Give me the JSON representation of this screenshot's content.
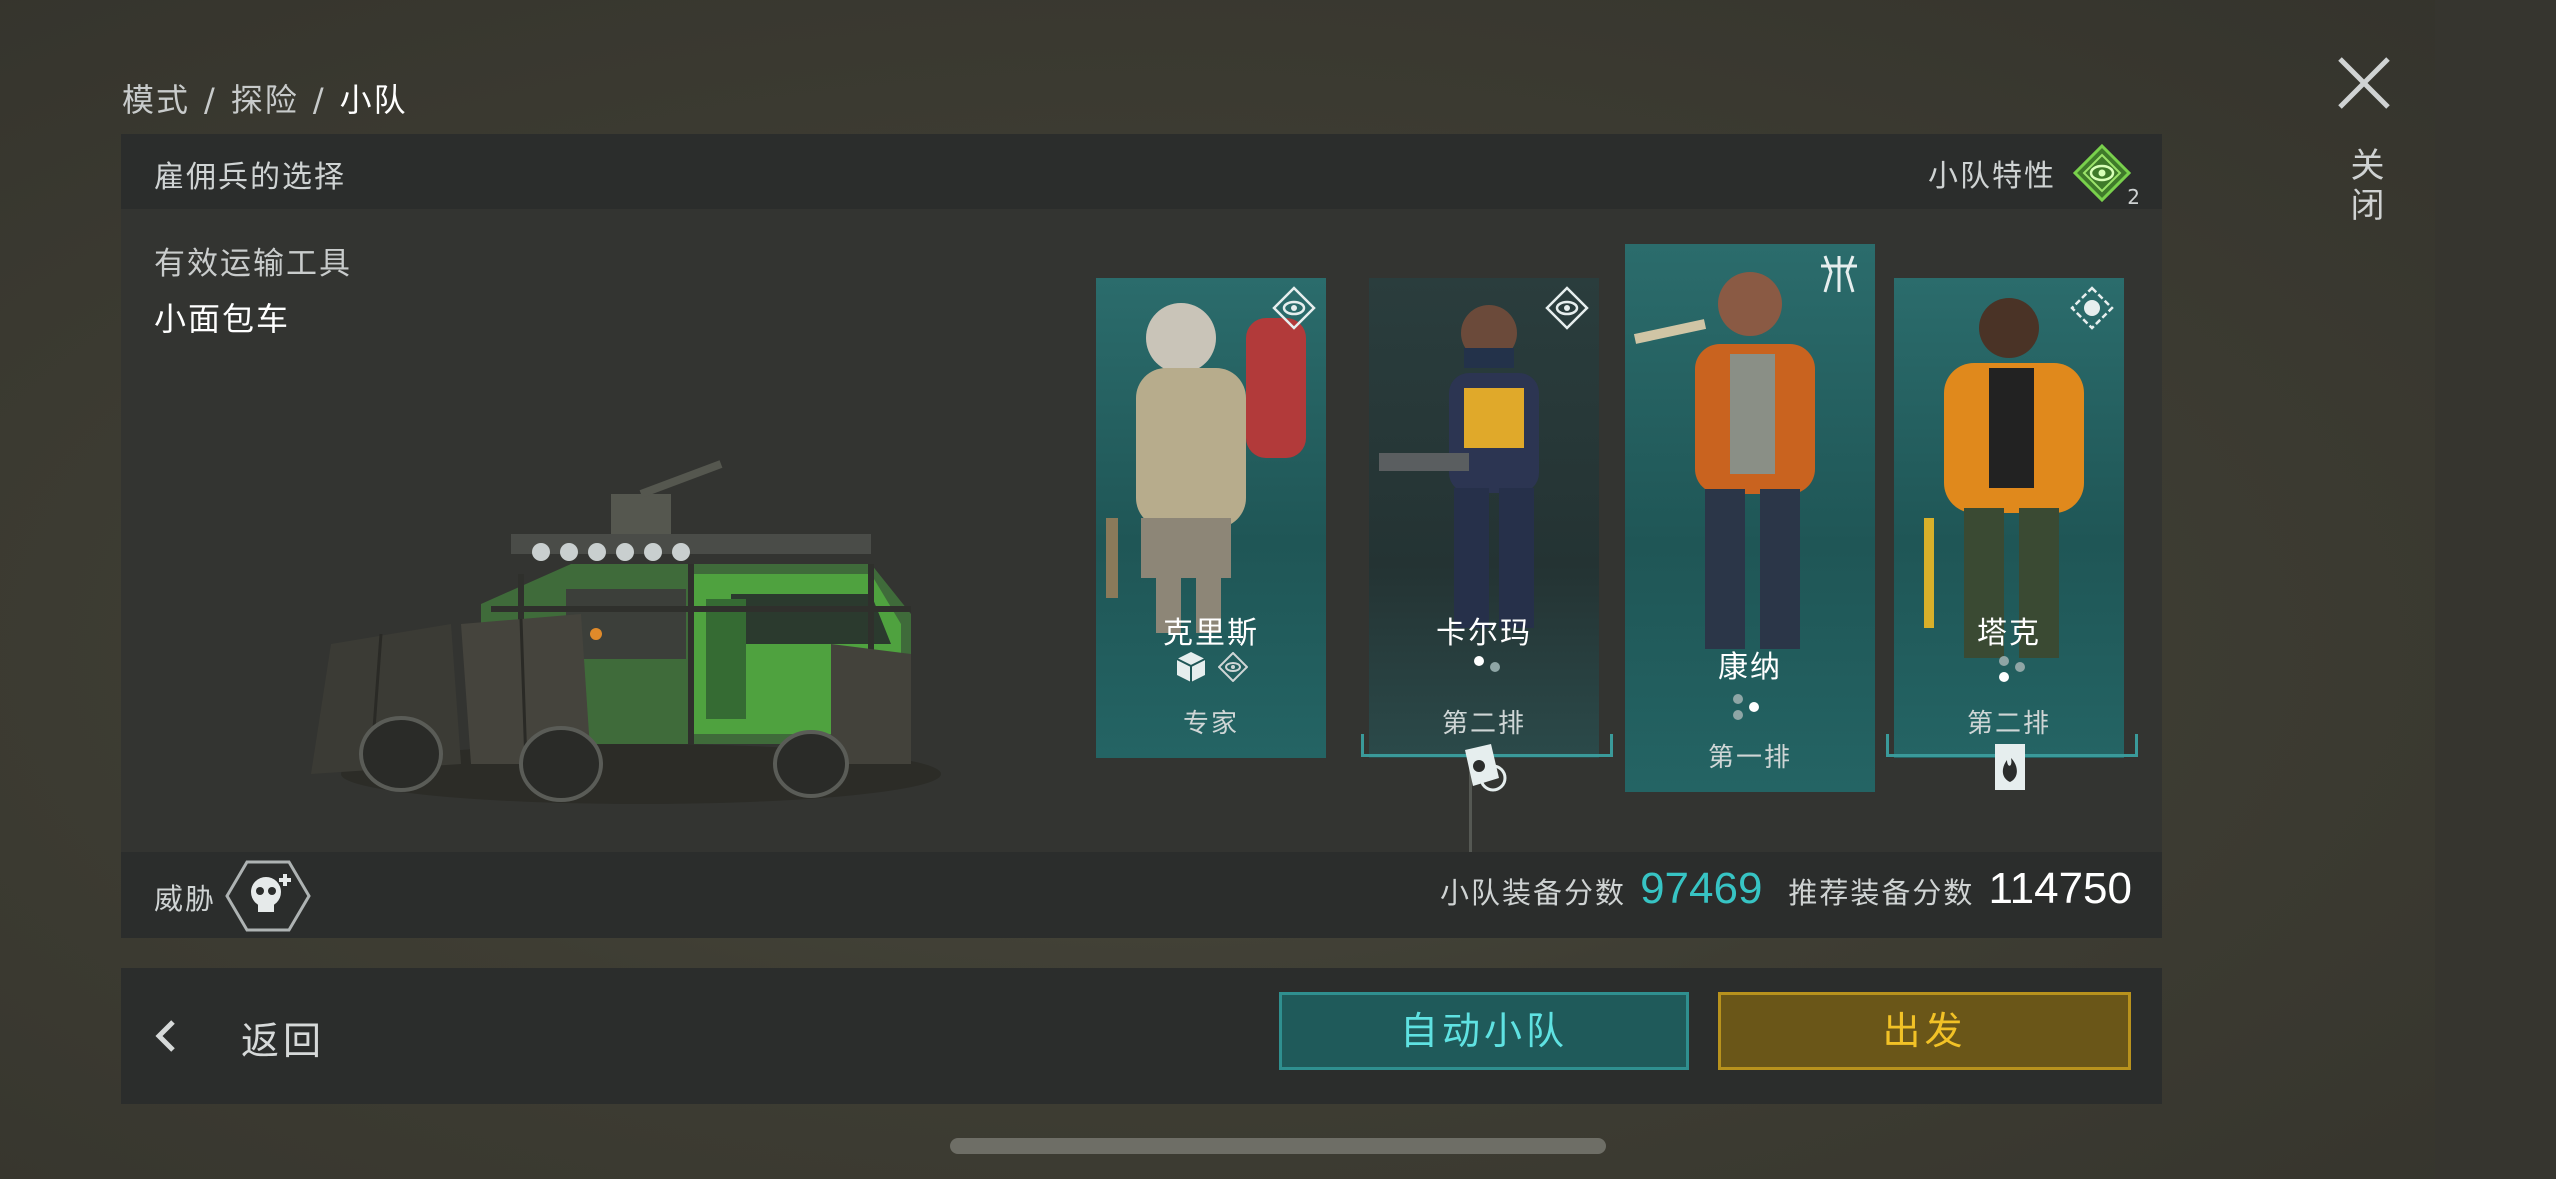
{
  "breadcrumb": {
    "items": [
      "模式",
      "探险",
      "小队"
    ],
    "separator": "/"
  },
  "close": {
    "label": "关闭",
    "icon": "close-icon"
  },
  "panel": {
    "title": "雇佣兵的选择",
    "traits": {
      "label": "小队特性",
      "count": "2",
      "icon": "eye-hex-icon",
      "color": "#5cc43a"
    },
    "transport_label": "有效运输工具",
    "vehicle_name": "小面包车",
    "threat_label": "威胁",
    "threat_icon": "skull-hex-icon",
    "squad_score_label": "小队装备分数",
    "squad_score": "97469",
    "recommended_label": "推荐装备分数",
    "recommended_score": "114750",
    "score_color": "#37c4c4"
  },
  "squad": [
    {
      "name": "克里斯",
      "role": "专家",
      "class_icon": "eye-icon",
      "extra_icons": [
        "cube-icon",
        "eye-icon"
      ]
    },
    {
      "name": "卡尔玛",
      "role": "第二排",
      "class_icon": "eye-icon",
      "badge_icon": "grenade-icon"
    },
    {
      "name": "康纳",
      "role": "第一排",
      "class_icon": "claw-icon"
    },
    {
      "name": "塔克",
      "role": "第二排",
      "class_icon": "grenade-icon",
      "badge_icon": "fire-icon"
    }
  ],
  "bottom": {
    "back_label": "返回",
    "auto_label": "自动小队",
    "go_label": "出发"
  }
}
